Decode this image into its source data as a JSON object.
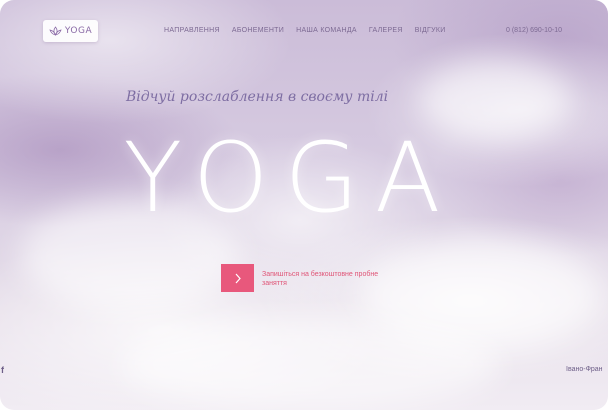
{
  "header": {
    "logo_text": "YOGA",
    "nav": [
      {
        "label": "НАПРАВЛЕННЯ"
      },
      {
        "label": "АБОНЕМЕНТИ"
      },
      {
        "label": "НАША КОМАНДА"
      },
      {
        "label": "ГАЛЕРЕЯ"
      },
      {
        "label": "ВІДГУКИ"
      }
    ],
    "phone": "0 (812) 690-10-10"
  },
  "hero": {
    "tagline": "Відчуй розслаблення в своєму тілі",
    "title": "YOGA",
    "cta_text": "Запишіться на безкоштовне пробне заняття"
  },
  "footer": {
    "social_icon": "facebook-icon",
    "social_letter": "f",
    "city": "Івано-Фран"
  },
  "colors": {
    "accent": "#e8587c",
    "nav_text": "#7d6a93",
    "tagline": "#7e6ea3"
  }
}
